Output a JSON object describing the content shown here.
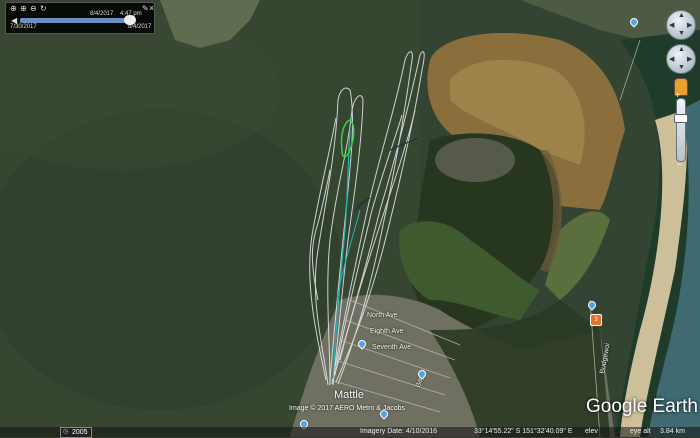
{
  "map": {
    "type": "satellite",
    "imagery_date": "4/10/2016",
    "coordinates_text": "33°14'55.22\" S 151°32'40.09\" E",
    "elevation_label": "elev",
    "eye_alt_label": "eye alt",
    "eye_alt_value": "3.84 km",
    "historical_imagery_year": "2005",
    "attribution": "Image © 2017 AERO Metro & Jacobs",
    "logo": "Google Earth",
    "place_label": "Mattle",
    "street_labels": [
      "North Ave",
      "Eighth Ave",
      "Seventh Ave",
      "Budgewoi",
      "Bay"
    ],
    "route_number": "3",
    "track_colors": {
      "white": "#e8edf2",
      "green": "#34d24a",
      "teal": "#1fb7b0",
      "dark": "#1b2f4a"
    }
  },
  "time_slider": {
    "start_date": "7/30/2017",
    "end_date": "8/4/2017",
    "current_date": "8/4/2017",
    "current_time": "4:47 pm"
  }
}
